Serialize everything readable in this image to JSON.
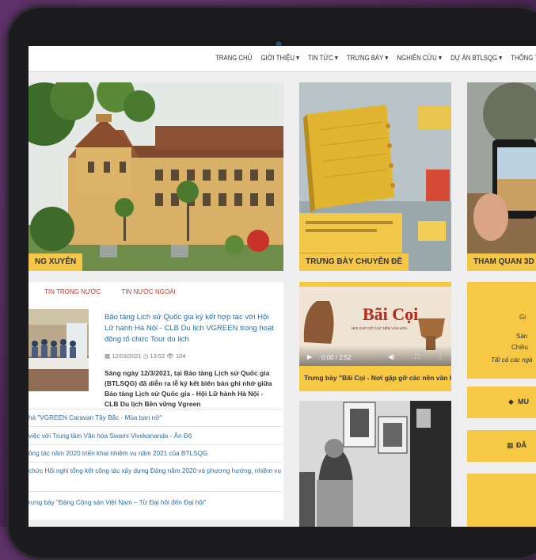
{
  "nav": {
    "items": [
      "TRANG CHỦ",
      "GIỚI THIỆU ▾",
      "TIN TỨC ▾",
      "TRƯNG BÀY ▾",
      "NGHIÊN CỨU ▾",
      "DỰ ÁN BTLSQG ▾",
      "THÔNG TIN K"
    ]
  },
  "hero": {
    "museum_tag": "NG XUYÊN",
    "exhibit_tag": "TRƯNG BÀY CHUYÊN ĐỀ",
    "tour_tag": "THAM QUAN 3D"
  },
  "news": {
    "tabs": [
      "TIN TRONG NƯỚC",
      "TIN NƯỚC NGOÀI"
    ],
    "headline": "Bảo tàng Lịch sử Quốc gia ký kết hợp tác với Hội Lữ hành Hà Nội - CLB Du lịch VGREEN trong hoạt động tổ chức Tour du lịch",
    "date": "12/03/2021",
    "time": "13:52",
    "views": "104",
    "summary": "Sáng ngày 12/3/2021, tại Bảo tàng Lịch sử Quốc gia (BTLSQG) đã diễn ra lễ ký kết biên bản ghi nhớ giữa Bảo tàng Lịch sử Quốc gia - Hội Lữ hành Hà Nội - CLB Du lịch Bền vững Vgreen",
    "list": [
      "hà \"VGREEN Caravan Tây Bắc - Mùa ban nở\"",
      "việc với Trung tâm Văn hóa Swami Vivekananda - Ấn Độ",
      "ông tác năm 2020 triển khai nhiệm vụ năm 2021 của BTLSQG",
      "chức Hội nghị tổng kết công tác xây dựng Đảng năm 2020 và phương hướng, nhiệm vụ năm",
      "rưng bày \"Đảng Cộng sản Việt Nam – Từ Đại hội đến Đại hội\""
    ]
  },
  "video": {
    "title": "Bãi Cọi",
    "subtitle": "NƠI GẶP GỠ CÁC NỀN VĂN HÓA",
    "time": "0:00 / 2:52",
    "caption": "Trưng bày \"Bãi Cọi - Nơi gặp gỡ các nền văn hóa\""
  },
  "right": {
    "lines": [
      "Gi",
      "Sán",
      "Chiều",
      "Tất cả các ngà"
    ],
    "btn1": "MU",
    "btn2": "ĐĂ"
  },
  "colors": {
    "accent": "#f7c843",
    "link": "#2b6ca3",
    "tab": "#c0392b"
  }
}
